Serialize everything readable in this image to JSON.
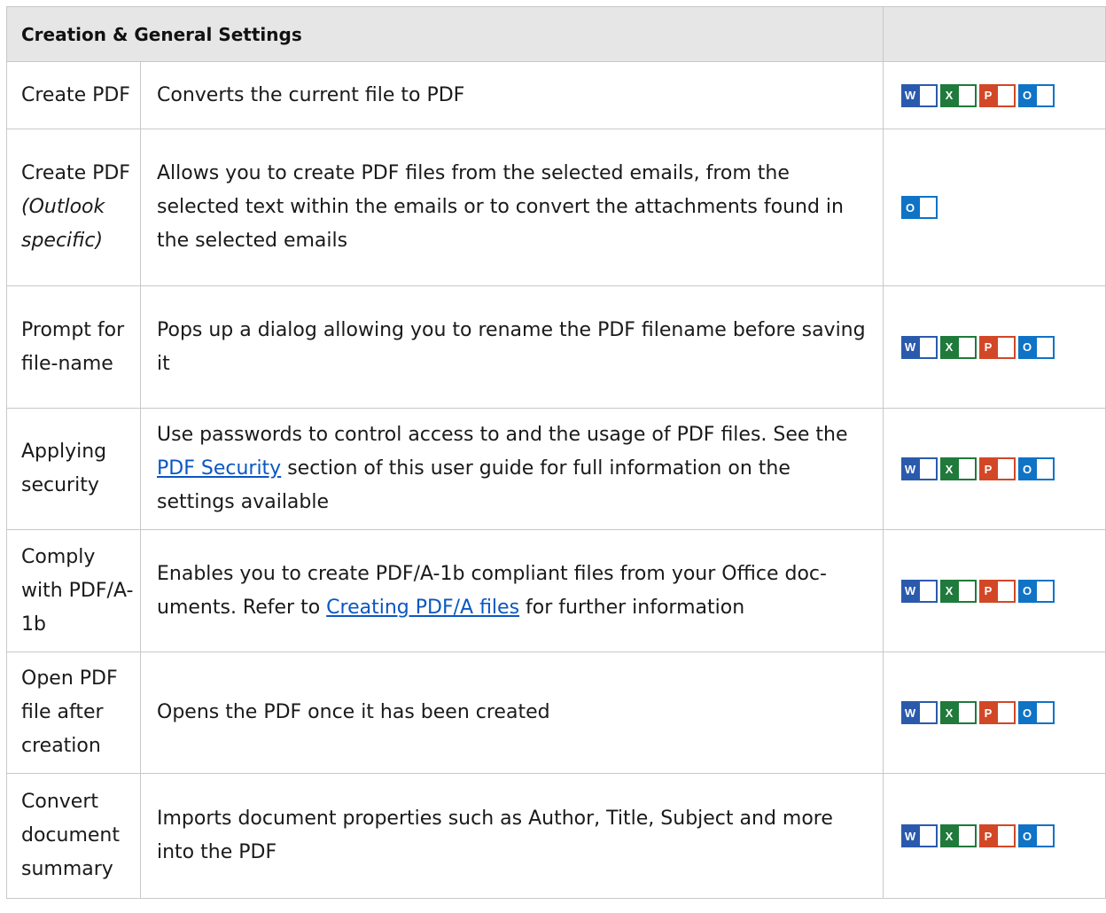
{
  "header": {
    "title": "Creation & General Settings"
  },
  "colors": {
    "word": "#2b5aad",
    "excel": "#1f7a3b",
    "powerpoint": "#d24726",
    "outlook": "#0f73c6",
    "link": "#0a57c2",
    "header_bg": "#e6e6e6"
  },
  "icons": {
    "word_letter": "W",
    "excel_letter": "X",
    "powerpoint_letter": "P",
    "outlook_letter": "O"
  },
  "rows": [
    {
      "name": "Create PDF",
      "desc": "Converts the current file to PDF"
    },
    {
      "name": "Create PDF",
      "name_note": "(Outlook specific)",
      "desc": "Allows you to create PDF files from the selected emails, from the selected text within the emails or to convert the attachments found in the selected emails"
    },
    {
      "name": "Prompt for file-name",
      "desc": "Pops up a dialog allowing you to rename the PDF filename before saving it"
    },
    {
      "name": "Applying security",
      "desc_pre": "Use passwords to control access to and the usage of PDF files. See the ",
      "desc_link": "PDF Security",
      "desc_post": " section of this user guide for full information on the settings available"
    },
    {
      "name": "Comply with PDF/A-1b",
      "desc_pre": "Enables you to create PDF/A-1b compliant files from your Office doc-uments. Refer to ",
      "desc_link": "Creating PDF/A files",
      "desc_post": " for further information"
    },
    {
      "name": "Open PDF file after creation",
      "desc": "Opens the PDF once it has been created"
    },
    {
      "name": "Convert document summary",
      "desc": "Imports document properties such as Author, Title, Subject and more into the PDF"
    }
  ]
}
